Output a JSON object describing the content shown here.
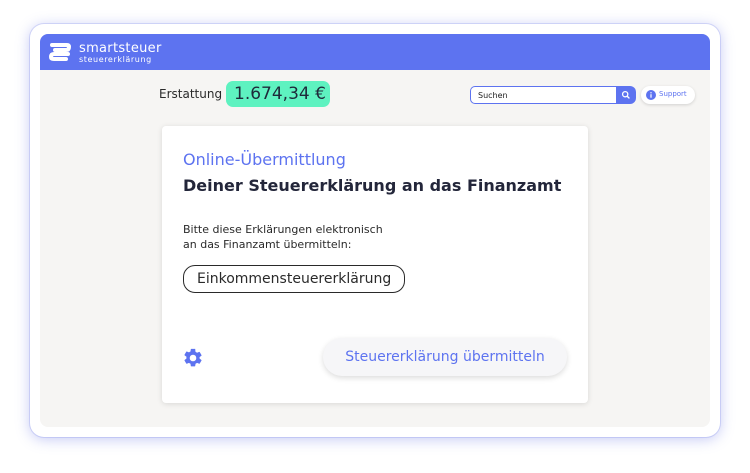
{
  "brand": {
    "name": "smartsteuer",
    "tagline": "steuererklärung",
    "accent_color": "#5d73f0",
    "refund_color": "#5ef2c0"
  },
  "refund": {
    "label": "Erstattung",
    "amount": "1.674,34 €"
  },
  "search": {
    "placeholder": "Suchen",
    "icon": "search-icon"
  },
  "support": {
    "label": "Support",
    "icon": "info-icon"
  },
  "card": {
    "title": "Online-Übermittlung",
    "subtitle": "Deiner Steuererklärung an das Finanzamt",
    "description_line1": "Bitte diese Erklärungen elektronisch",
    "description_line2": "an das Finanzamt übermitteln:",
    "declaration_chip": "Einkommensteuererklärung",
    "settings_icon": "gear-icon",
    "submit_label": "Steuererklärung übermitteln"
  }
}
